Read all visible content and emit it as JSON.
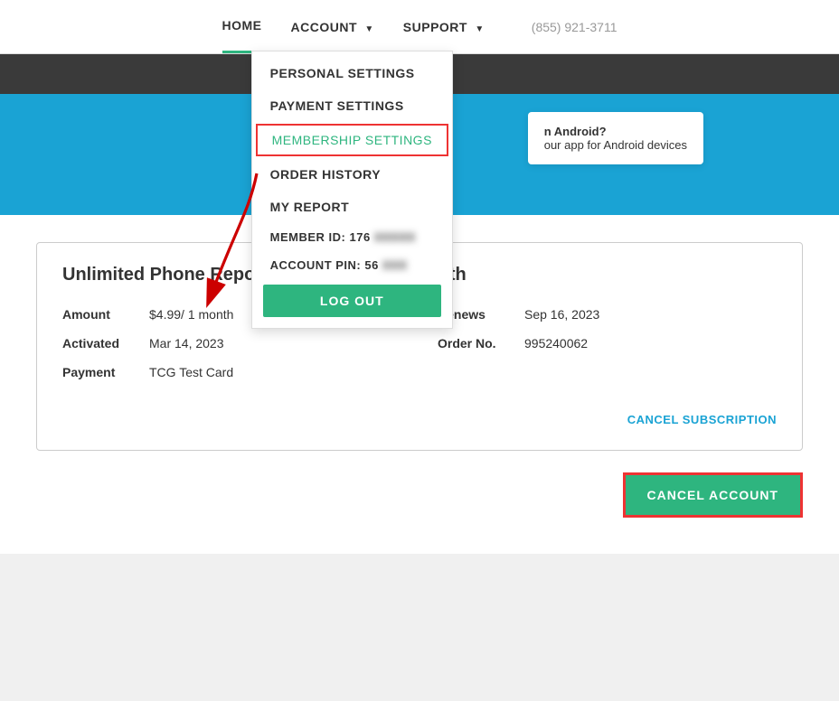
{
  "header": {
    "nav_items": [
      {
        "id": "home",
        "label": "HOME",
        "active": true
      },
      {
        "id": "account",
        "label": "ACCOUNT",
        "dropdown": true
      },
      {
        "id": "support",
        "label": "SUPPORT",
        "dropdown": true
      }
    ],
    "phone": "(855) 921-3711"
  },
  "dropdown": {
    "items": [
      {
        "id": "personal-settings",
        "label": "Personal Settings",
        "highlighted": false
      },
      {
        "id": "payment-settings",
        "label": "Payment Settings",
        "highlighted": false
      },
      {
        "id": "membership-settings",
        "label": "Membership Settings",
        "highlighted": true
      },
      {
        "id": "order-history",
        "label": "Order History",
        "highlighted": false
      },
      {
        "id": "my-report",
        "label": "My Report",
        "highlighted": false
      }
    ],
    "member_id_label": "Member ID:",
    "member_id_value": "176",
    "member_id_blurred": "XXXXX",
    "account_pin_label": "Account Pin:",
    "account_pin_value": "56",
    "account_pin_blurred": "XXX",
    "logout_label": "LOG OUT"
  },
  "android_promo": {
    "title": "n Android?",
    "body": "our app for Android devices"
  },
  "membership": {
    "title": "Unlimited Phone Report Membership - 1 month",
    "amount_label": "Amount",
    "amount_value": "$4.99/ 1 month",
    "renews_label": "Renews",
    "renews_value": "Sep 16, 2023",
    "activated_label": "Activated",
    "activated_value": "Mar 14, 2023",
    "order_label": "Order No.",
    "order_value": "995240062",
    "payment_label": "Payment",
    "payment_value": "TCG Test Card",
    "cancel_subscription_label": "CANCEL SUBSCRIPTION",
    "cancel_account_label": "CANCEL ACCOUNT"
  }
}
